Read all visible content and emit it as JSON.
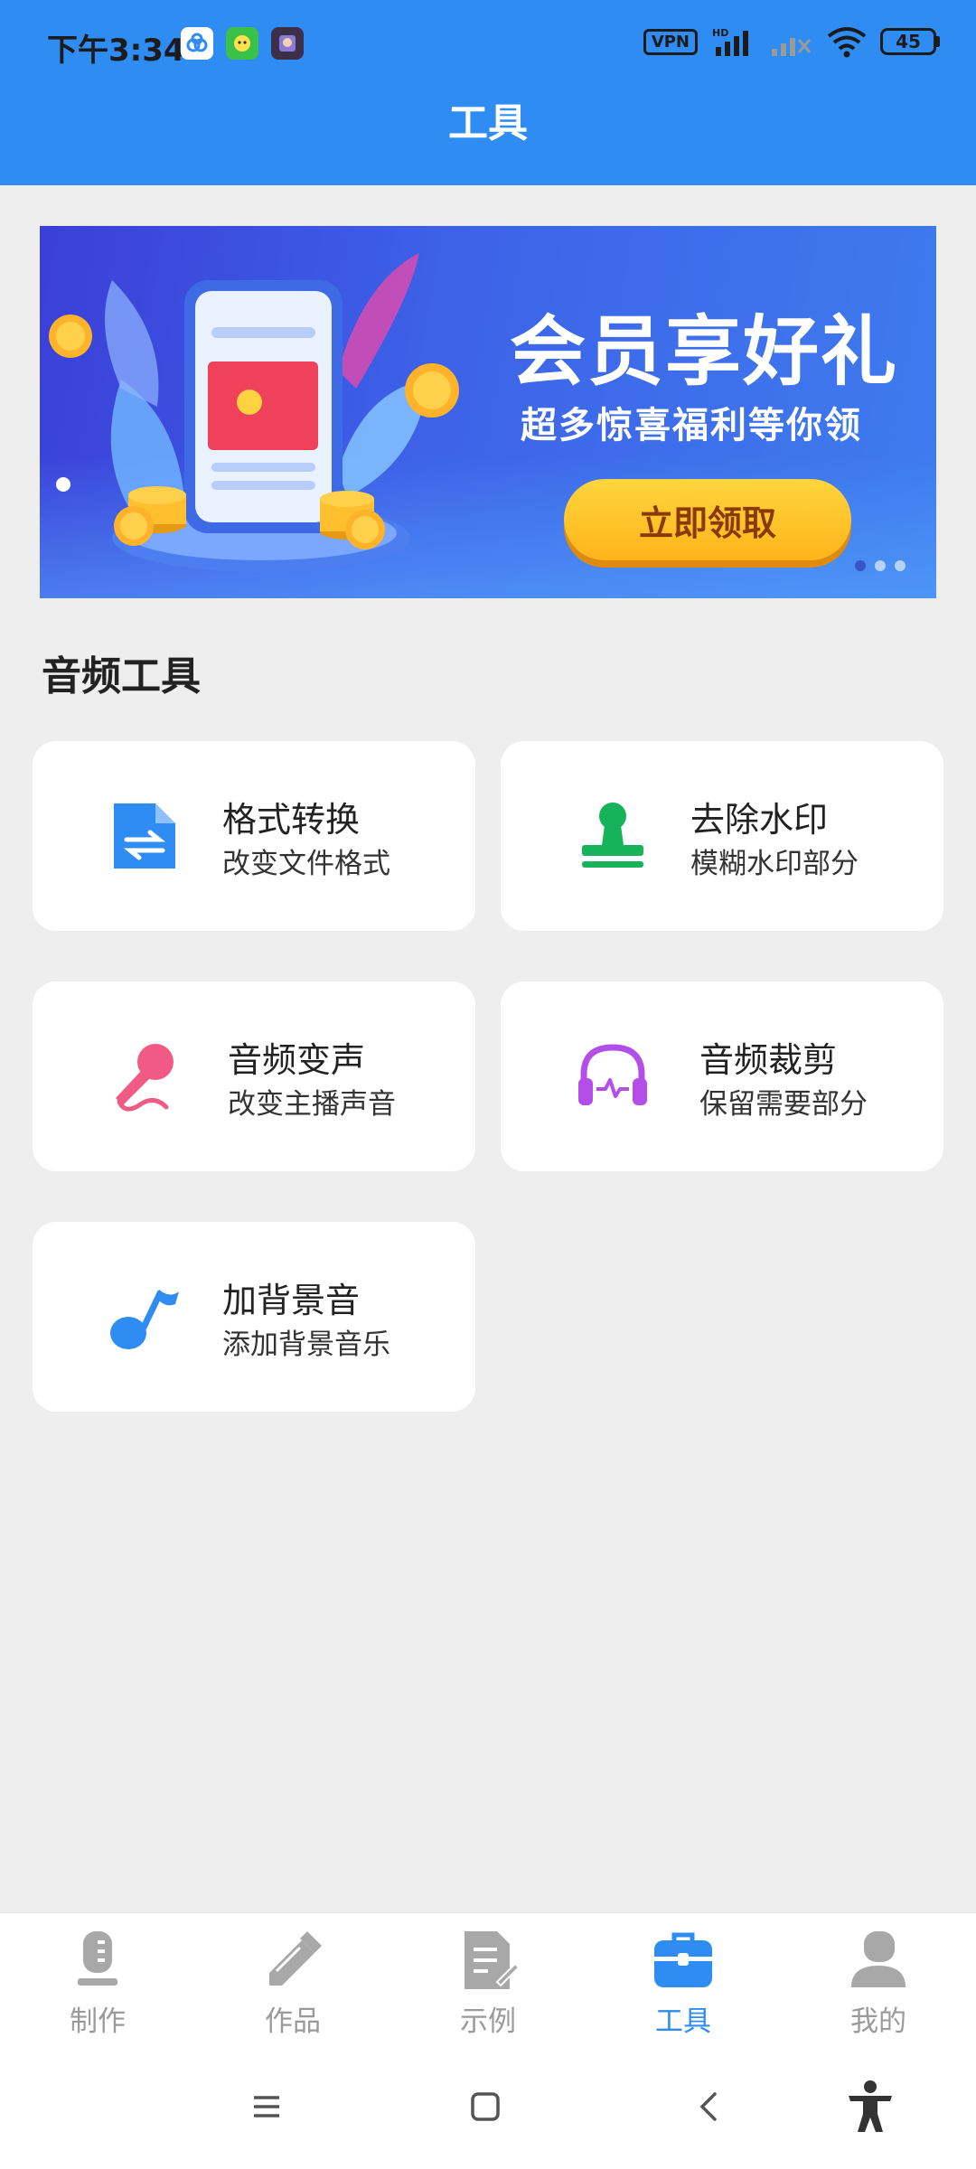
{
  "status_bar": {
    "time": "下午3:34",
    "vpn": "VPN",
    "signal_label": "HD",
    "battery": "45"
  },
  "header": {
    "title": "工具"
  },
  "banner": {
    "title": "会员享好礼",
    "subtitle": "超多惊喜福利等你领",
    "button": "立即领取",
    "slide_count": 3,
    "active_slide": 1
  },
  "section": {
    "title": "音频工具"
  },
  "tools": [
    {
      "title": "格式转换",
      "desc": "改变文件格式",
      "icon": "file-convert-icon",
      "color": "#2f8cf2"
    },
    {
      "title": "去除水印",
      "desc": "模糊水印部分",
      "icon": "stamp-icon",
      "color": "#16b35a"
    },
    {
      "title": "音频变声",
      "desc": "改变主播声音",
      "icon": "microphone-icon",
      "color": "#f25a86"
    },
    {
      "title": "音频裁剪",
      "desc": "保留需要部分",
      "icon": "headphones-icon",
      "color": "#b44ee8"
    },
    {
      "title": "加背景音",
      "desc": "添加背景音乐",
      "icon": "music-note-icon",
      "color": "#2f8cf2"
    }
  ],
  "bottom_nav": {
    "active": "工具",
    "items": [
      {
        "label": "制作",
        "icon": "microphone-icon"
      },
      {
        "label": "作品",
        "icon": "edit-icon"
      },
      {
        "label": "示例",
        "icon": "document-icon"
      },
      {
        "label": "工具",
        "icon": "toolbox-icon"
      },
      {
        "label": "我的",
        "icon": "user-icon"
      }
    ]
  },
  "colors": {
    "primary": "#2f8cf2",
    "background": "#eeeeee"
  }
}
